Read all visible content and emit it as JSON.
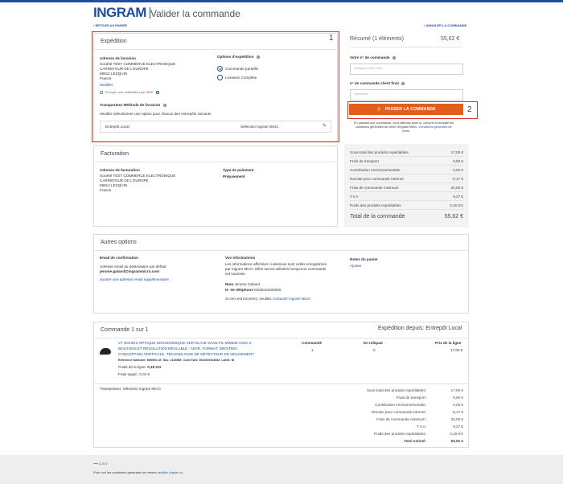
{
  "header": {
    "brand": "INGRAM",
    "title": "Valider la commande",
    "back_link": "RETOUR AU PANIER",
    "cancel_link": "ANNULER LA COMMANDE"
  },
  "expedition": {
    "title": "Expédition",
    "address_label": "Adresse de livraison",
    "address_lines": [
      "Société TEST COMMERCE ELECTRONIQUE",
      "CARREFOUR DE L'EUROPE",
      "59812 LESQUIN",
      "France"
    ],
    "modify": "Modifier",
    "sms_label": "Envoyer une notification par SMS",
    "options_label": "Options d'expédition",
    "option_partial": "Commande partielle",
    "option_complete": "Livraison Complète",
    "carrier_label": "Transporteur Méthode de livraison",
    "carrier_help": "Veuillez sélectionner une option pour chacun des entrepôts suivants",
    "warehouse": "Entrepôt Local",
    "carrier_choice": "Sélection Ingram Micro",
    "box_number": "1"
  },
  "summary": {
    "title": "Résumé (1 éléments)",
    "amount": "55,62 €",
    "order_no_label": "Votre n° de commande",
    "order_no_placeholder": "Indiquez-votre-code",
    "client_order_label": "n° de commande client final",
    "client_order_placeholder": "Optionnel",
    "cta": "PASSER LA COMMANDE",
    "box_number": "2",
    "legal_1": "En passant une commande, vous affirmez avoir lu, compris et accepté les",
    "legal_2": "conditions générales de vente d'Ingram Micro.",
    "legal_link": "Conditions générales de",
    "legal_link_2": "vente",
    "rows": [
      {
        "label": "Sous-total des produits expédiables",
        "value": "17,00 €"
      },
      {
        "label": "Frais de transport",
        "value": "9,50 €"
      },
      {
        "label": "Contribution environnementale",
        "value": "0,02 €"
      },
      {
        "label": "Remise pour commande internet",
        "value": "-0,17 €"
      },
      {
        "label": "Frais de commande minimum",
        "value": "20,00 €"
      },
      {
        "label": "T.V.A",
        "value": "9,27 €"
      },
      {
        "label": "Poids des produits expédiables",
        "value": "0,18 KG"
      }
    ],
    "total_label": "Total de la commande",
    "total_value": "55,62 €"
  },
  "billing": {
    "title": "Facturation",
    "address_label": "Adresse de facturation",
    "address_lines": [
      "Société TEST COMMERCE ELECTRONIQUE",
      "CARREFOUR DE L'EUROPE",
      "59812 LESQUIN",
      "France"
    ],
    "payment_label": "Type de paiement",
    "payment_value": "Prépaiement"
  },
  "other": {
    "title": "Autres options",
    "email_label": "Email de confirmation",
    "email_help": "Adresse email du destinataire par défaut",
    "email": "jerome.galand@ingrammicro.com",
    "add_email": "Ajouter une adresse email supplémentaire",
    "info_label": "Vos informations",
    "info_text": [
      "Les informations affichées ci-dessous sont celles enregistrées",
      "par Ingram Micro. Elles seront utilisées lorsqu'une commande",
      "est soumise."
    ],
    "name_label": "Nom",
    "name_value": "Jerome Galand",
    "phone_label": "N° de téléphone",
    "phone_value": "0203010203000",
    "incorrect_text": "Si ceci est incorrect, veuillez",
    "incorrect_link": "contacter Ingram Micro",
    "notes_label": "Notes du panier",
    "notes_add": "Ajouter"
  },
  "order": {
    "title": "Commande 1 sur 1",
    "shipping_from": "Expédition depuis: Entrepôt Local",
    "product_lines": [
      "V7 SOURIS OPTIQUE ERGONOMIQUE VERTICALE SANS FIL MW500 AVEC 6",
      "BOUTONS ET RÉSOLUTION RÉGLABLE - NOIR. FORMAT: DROITIER,",
      "CONCEPTION VERTICALE. TECHNOLOGIE DE DÉTECTEUR DE MOUVEMENT"
    ],
    "ref_label": "Référence fabricant:",
    "ref_value": "MW500-1E",
    "sku_label": "Sku:",
    "sku_value": "J154589",
    "ean_label": "Code EAN:",
    "ean_value": "0662919104684",
    "lang_label": "LANG:",
    "lang_value": "NI",
    "weight_label": "Poids de la ligne:",
    "weight_value": "0,18 KG",
    "fees_label": "Frais suppl.:",
    "fees_value": "0,02 €",
    "col_ordered": "Commandé",
    "col_backorder": "En reliquat",
    "col_price": "Prix de la ligne",
    "ordered": "1",
    "backorder": "0",
    "price": "17,00 €",
    "carrier": "Transporteur: Sélection Ingram Micro",
    "totals": [
      {
        "label": "Sous-total des produits expédiables:",
        "value": "17,00 €"
      },
      {
        "label": "Frais de transport:",
        "value": "9,50 €"
      },
      {
        "label": "Contribution environnementale:",
        "value": "0,02 €"
      },
      {
        "label": "Remise pour commande internet:",
        "value": "-0,17 €"
      },
      {
        "label": "Frais de commande minimum:",
        "value": "20,00 €"
      },
      {
        "label": "T.V.A:",
        "value": "9,27 €"
      },
      {
        "label": "Poids des produits expédiables:",
        "value": "0,18 KG"
      }
    ],
    "total_label": "Total estimé:",
    "total_value": "55,62 €"
  },
  "footer": {
    "cgv": "C.G.V",
    "conditions_text": "Pour voir les conditions générales de ventes",
    "conditions_link": "veuillez cliquer ici..."
  },
  "colors": {
    "brand": "#1b4f9b",
    "cta": "#e45d1e",
    "highlight": "#d9302a"
  }
}
